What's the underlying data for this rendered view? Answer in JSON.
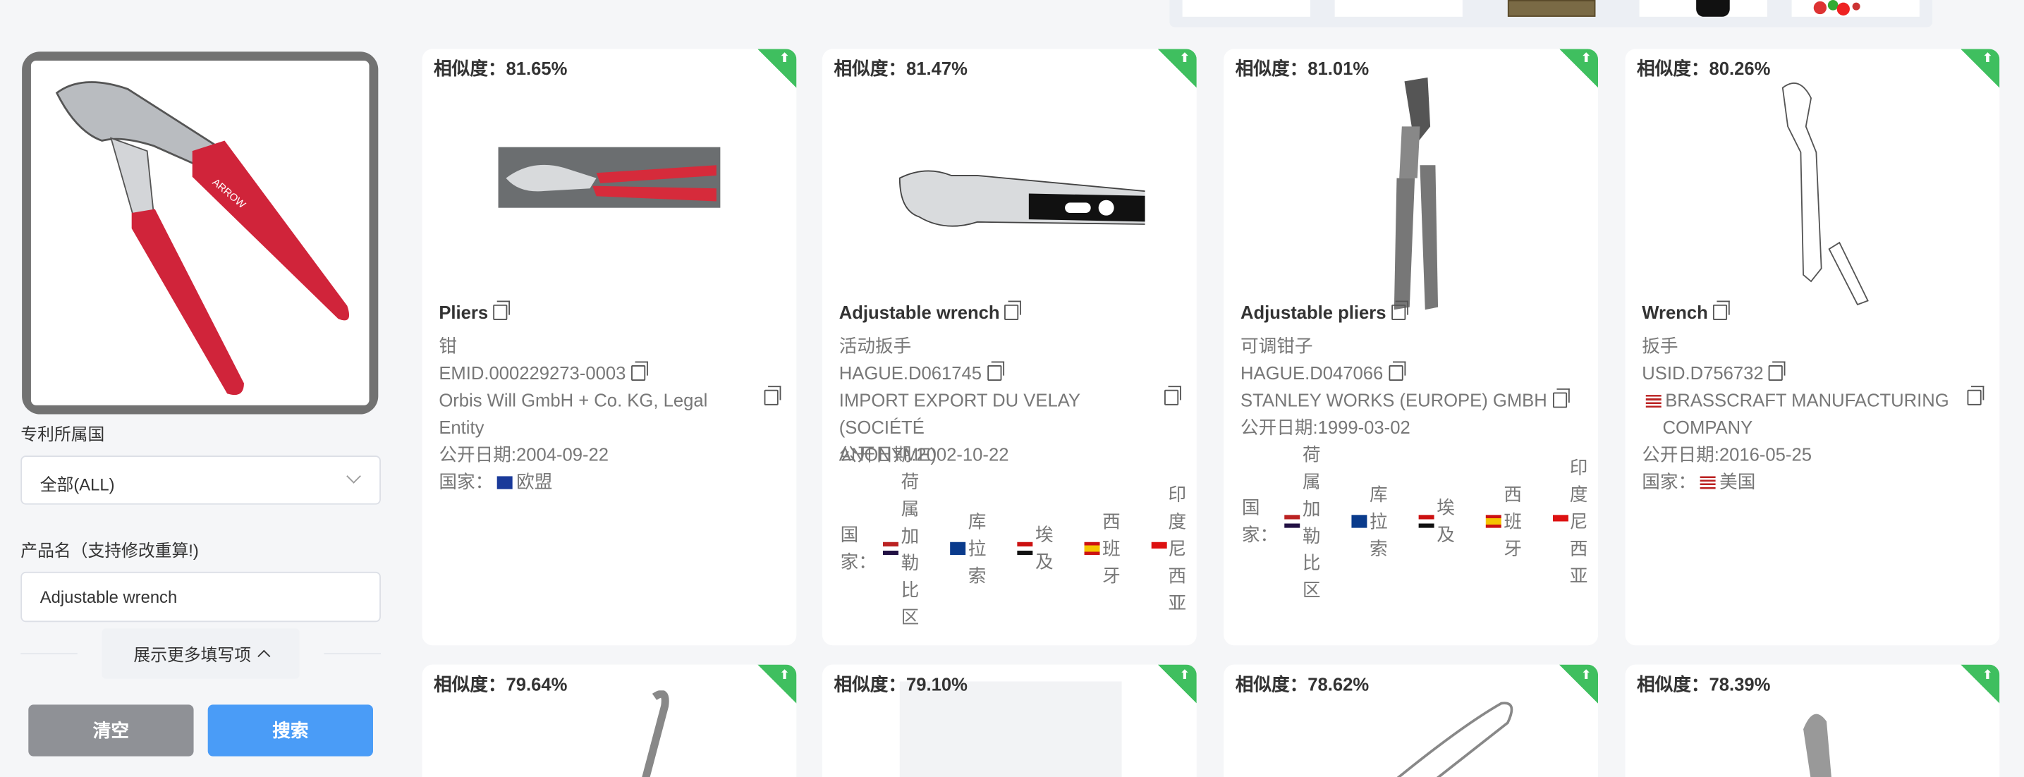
{
  "filters": {
    "country_label": "专利所属国",
    "country_value": "全部(ALL)",
    "product_label": "产品名（支持修改重算!)",
    "product_value": "Adjustable wrench",
    "more_label": "展示更多填写项",
    "clear_label": "清空",
    "search_label": "搜索"
  },
  "results": [
    {
      "similarity": "相似度：81.65%",
      "title": "Pliers",
      "cn_name": "钳",
      "id": "EMID.000229273-0003",
      "applicant_1": "Orbis Will GmbH + Co. KG, Legal",
      "applicant_2": "Entity",
      "pub_date": "公开日期:2004-09-22",
      "country_label": "国家：",
      "country_name": "欧盟"
    },
    {
      "similarity": "相似度：81.47%",
      "title": "Adjustable wrench",
      "cn_name": "活动扳手",
      "id": "HAGUE.D061745",
      "applicant_1": "IMPORT EXPORT DU VELAY (SOCIÉTÉ",
      "applicant_2": "ANONYME)",
      "pub_date": "公开日期:2002-10-22",
      "country_label": "国家：",
      "countries": [
        "荷属加勒比区",
        "库拉索",
        "埃及",
        "西班牙",
        "印度尼西亚"
      ]
    },
    {
      "similarity": "相似度：81.01%",
      "title": "Adjustable pliers",
      "cn_name": "可调钳子",
      "id": "HAGUE.D047066",
      "applicant_1": "STANLEY WORKS (EUROPE) GMBH",
      "pub_date": "公开日期:1999-03-02",
      "country_label": "国家：",
      "countries": [
        "荷属加勒比区",
        "库拉索",
        "埃及",
        "西班牙",
        "印度尼西亚"
      ]
    },
    {
      "similarity": "相似度：80.26%",
      "title": "Wrench",
      "cn_name": "扳手",
      "id": "USID.D756732",
      "applicant_1": "BRASSCRAFT MANUFACTURING",
      "applicant_2": "COMPANY",
      "pub_date": "公开日期:2016-05-25",
      "country_label": "国家：",
      "country_name": "美国"
    },
    {
      "similarity": "相似度：79.64%"
    },
    {
      "similarity": "相似度：79.10%"
    },
    {
      "similarity": "相似度：78.62%"
    },
    {
      "similarity": "相似度：78.39%"
    }
  ],
  "icons": {
    "copy": "copy-icon",
    "badge": "upload-arrow-icon",
    "chevron": "chevron-down-icon"
  }
}
